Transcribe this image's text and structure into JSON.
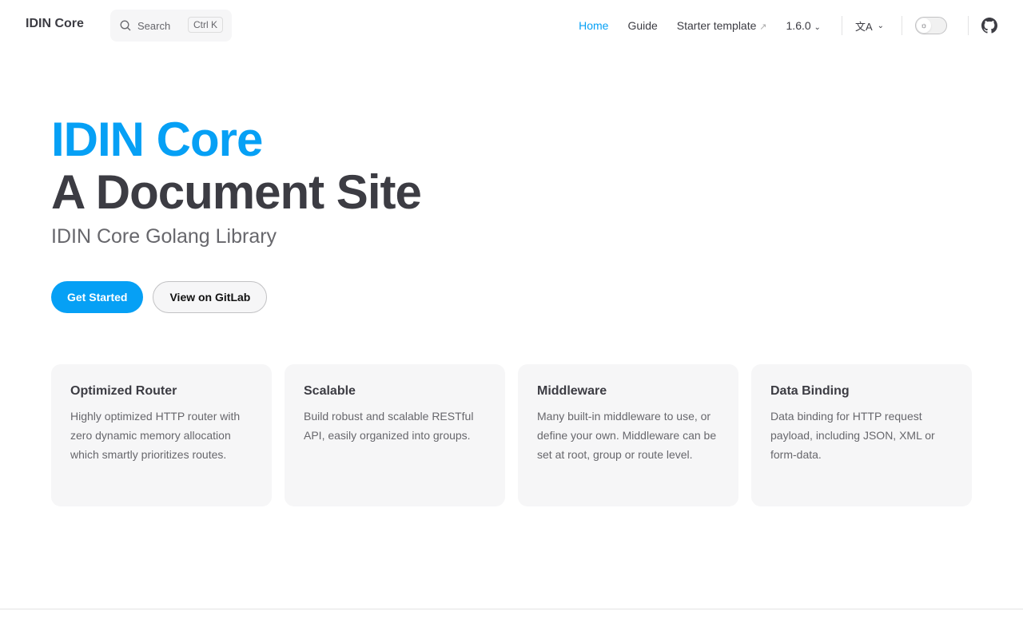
{
  "nav": {
    "logo": "IDIN Core",
    "search_placeholder": "Search",
    "search_kbd": "Ctrl K",
    "links": [
      "Home",
      "Guide",
      "Starter template"
    ],
    "external_icon": "↗",
    "version": "1.6.0"
  },
  "hero": {
    "name": "IDIN Core",
    "text": "A Document Site",
    "tagline": "IDIN Core Golang Library",
    "actions": [
      "Get Started",
      "View on GitLab"
    ]
  },
  "features": [
    {
      "title": "Optimized Router",
      "details": "Highly optimized HTTP router with zero dynamic memory allocation which smartly prioritizes routes."
    },
    {
      "title": "Scalable",
      "details": "Build robust and scalable RESTful API, easily organized into groups."
    },
    {
      "title": "Middleware",
      "details": "Many built-in middleware to use, or define your own. Middleware can be set at root, group or route level."
    },
    {
      "title": "Data Binding",
      "details": "Data binding for HTTP request payload, including JSON, XML or form-data."
    }
  ],
  "colors": {
    "brand": "#06a0f5",
    "text": "#3c3c43"
  }
}
